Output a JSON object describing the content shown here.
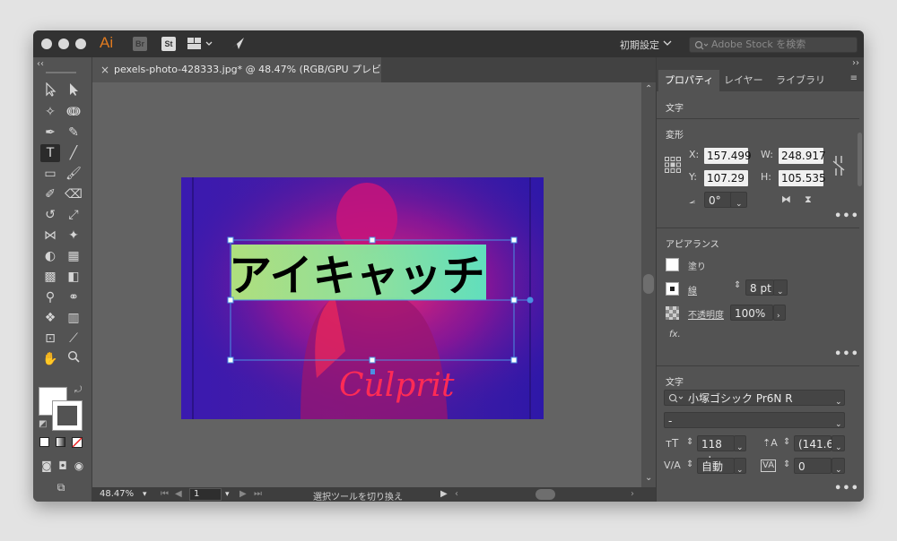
{
  "app": {
    "logo": "Ai",
    "bridge_label": "Br",
    "stock_label": "St",
    "workspace": "初期設定",
    "search_placeholder": "Adobe Stock を検索"
  },
  "document": {
    "tab_title": "pexels-photo-428333.jpg* @ 48.47% (RGB/GPU プレビュー)",
    "artwork_text": "アイキャッチ",
    "shirt_text": "Culprit"
  },
  "status_bar": {
    "zoom": "48.47%",
    "page": "1",
    "status_text": "選択ツールを切り換え"
  },
  "panel": {
    "tabs": [
      "プロパティ",
      "レイヤー",
      "ライブラリ"
    ],
    "section_type": "文字",
    "transform": {
      "title": "変形",
      "x_label": "X:",
      "x": "157.499",
      "y_label": "Y:",
      "y": "107.29",
      "w_label": "W:",
      "w": "248.917",
      "h_label": "H:",
      "h": "105.535",
      "angle": "0°"
    },
    "appearance": {
      "title": "アピアランス",
      "fill_label": "塗り",
      "stroke_label": "線",
      "stroke_value": "8 pt",
      "opacity_label": "不透明度",
      "opacity_value": "100%",
      "fx_label": "fx."
    },
    "character": {
      "title": "文字",
      "font": "小塚ゴシック Pr6N R",
      "style": "-",
      "size": "118 pt",
      "leading": "(141.6",
      "tracking": "自動",
      "kerning": "0"
    }
  },
  "colors": {
    "artboard_bg": "#3b1aa8",
    "highlight_gradient_start": "#b7f07a",
    "highlight_gradient_end": "#5ef0c0",
    "selection": "#4a90e2",
    "accent_logo": "#e07a1f"
  }
}
